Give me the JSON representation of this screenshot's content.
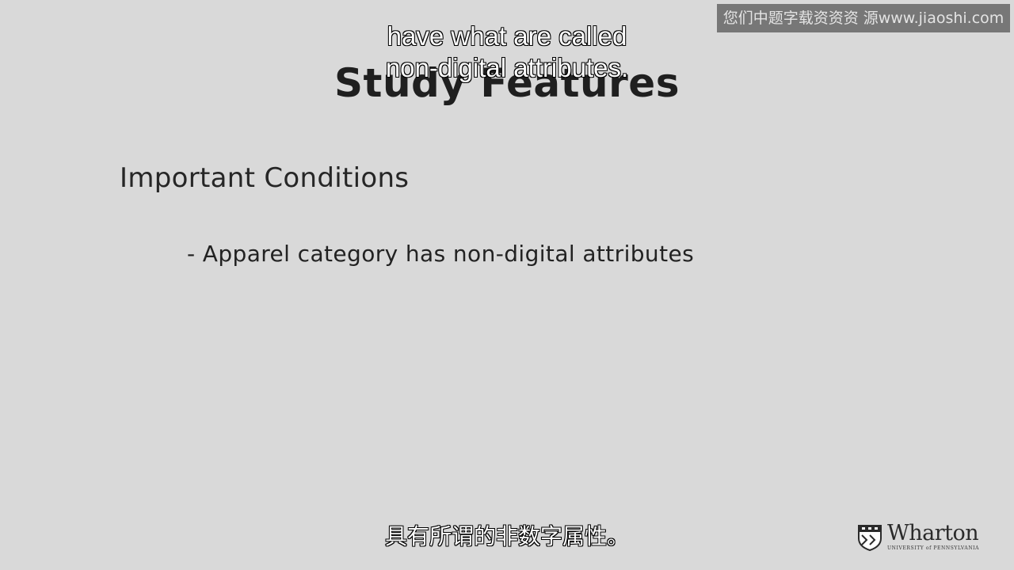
{
  "slide": {
    "title": "Study Features",
    "heading": "Important Conditions",
    "bullet": "- Apparel category has non-digital attributes"
  },
  "subtitles": {
    "english_line1": "have what are called",
    "english_line2": "non-digital attributes.",
    "chinese": "具有所谓的非数字属性。"
  },
  "watermark": {
    "text": "您们中题字载资资资 源www.jiaoshi.com"
  },
  "logo": {
    "name": "Wharton",
    "subtext": "UNIVERSITY of PENNSYLVANIA",
    "icon": "wharton-shield-icon"
  },
  "colors": {
    "background": "#d9d9d9",
    "text": "#222222",
    "subtitle_fill": "#ffffff",
    "subtitle_stroke": "#000000",
    "watermark_bg": "#6f6f6f"
  }
}
